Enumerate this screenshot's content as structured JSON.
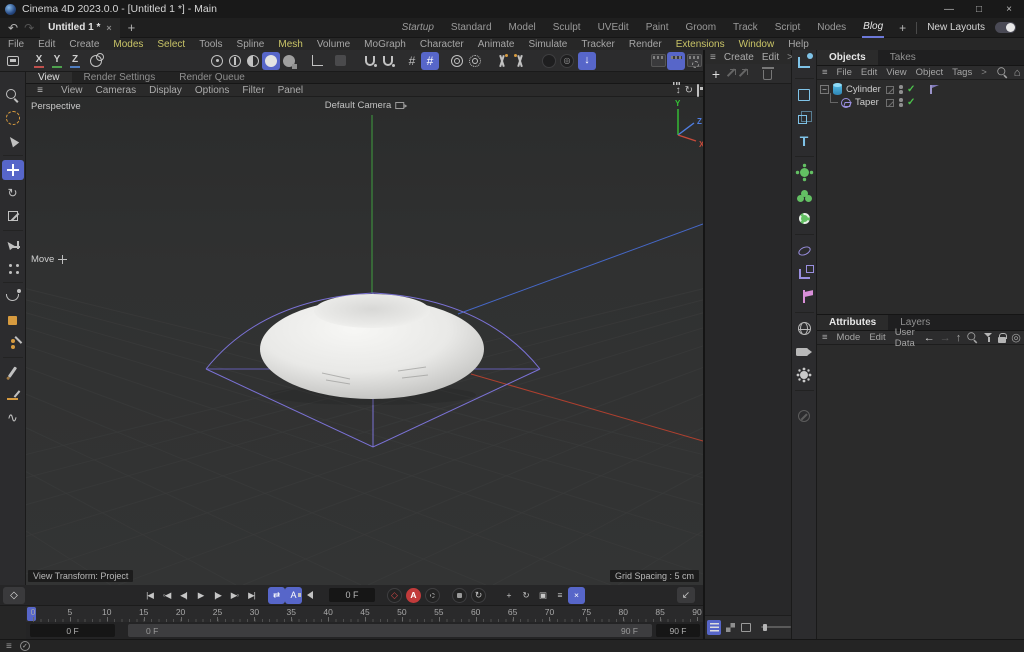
{
  "icons": {
    "hamburger": "≡",
    "check": "✓",
    "home": "⌂",
    "target": "◎",
    "rotate": "↻",
    "wave": "∿",
    "down_arrow": "↓",
    "grid": "#",
    "text_tool": "T",
    "updown": "↕",
    "plus": "+",
    "scale_arrow": "↔",
    "param": "▤",
    "box": "▣",
    "cross": "×"
  },
  "titlebar": {
    "title": "Cinema 4D 2023.0.0 - [Untitled 1 *] - Main",
    "minimize": "—",
    "maximize": "□",
    "close": "×"
  },
  "tabbar": {
    "undo": "↶",
    "redo": "↷",
    "document": "Untitled 1 *",
    "close": "×",
    "add": "+",
    "layouts": [
      {
        "label": "Startup",
        "italic": true
      },
      {
        "label": "Standard"
      },
      {
        "label": "Model"
      },
      {
        "label": "Sculpt"
      },
      {
        "label": "UVEdit"
      },
      {
        "label": "Paint"
      },
      {
        "label": "Groom"
      },
      {
        "label": "Track"
      },
      {
        "label": "Script"
      },
      {
        "label": "Nodes"
      },
      {
        "label": "Blog",
        "italic": true,
        "active": true
      }
    ],
    "add_layout": "+",
    "new_layouts": "New Layouts"
  },
  "menubar": {
    "items": [
      {
        "label": "File"
      },
      {
        "label": "Edit"
      },
      {
        "label": "Create"
      },
      {
        "label": "Modes",
        "hl": true
      },
      {
        "label": "Select",
        "hl": true
      },
      {
        "label": "Tools"
      },
      {
        "label": "Spline"
      },
      {
        "label": "Mesh",
        "hl": true
      },
      {
        "label": "Volume"
      },
      {
        "label": "MoGraph"
      },
      {
        "label": "Character"
      },
      {
        "label": "Animate"
      },
      {
        "label": "Simulate"
      },
      {
        "label": "Tracker"
      },
      {
        "label": "Render"
      },
      {
        "label": "Extensions",
        "hl": true
      },
      {
        "label": "Window",
        "hl": true
      },
      {
        "label": "Help"
      }
    ]
  },
  "toolbar": {
    "axis_x": "X",
    "axis_y": "Y",
    "axis_z": "Z"
  },
  "viewport": {
    "tabs": [
      {
        "label": "View",
        "active": true
      },
      {
        "label": "Render Settings"
      },
      {
        "label": "Render Queue"
      }
    ],
    "menu": [
      "View",
      "Cameras",
      "Display",
      "Options",
      "Filter",
      "Panel"
    ],
    "projection": "Perspective",
    "camera": "Default Camera",
    "tool_hint": "Move",
    "info_left": "View Transform: Project",
    "info_right": "Grid Spacing : 5 cm",
    "axis": {
      "x": "X",
      "y": "Y",
      "z": "Z"
    }
  },
  "materials_panel": {
    "menu": [
      "Create",
      "Edit",
      ">"
    ],
    "add": "+"
  },
  "objects_panel": {
    "tabs": [
      {
        "label": "Objects",
        "active": true
      },
      {
        "label": "Takes"
      }
    ],
    "menu": [
      "File",
      "Edit",
      "View",
      "Object",
      "Tags",
      ">"
    ],
    "expander": "−",
    "tree": [
      {
        "name": "Cylinder"
      },
      {
        "name": "Taper"
      }
    ]
  },
  "attributes_panel": {
    "tabs": [
      {
        "label": "Attributes",
        "active": true
      },
      {
        "label": "Layers"
      }
    ],
    "menu": [
      "Mode",
      "Edit",
      "User Data"
    ],
    "nav_back": "←",
    "nav_fwd": "→",
    "nav_up": "↑"
  },
  "timeline": {
    "ticks": [
      "0",
      "5",
      "10",
      "15",
      "20",
      "25",
      "30",
      "35",
      "40",
      "45",
      "50",
      "55",
      "60",
      "65",
      "70",
      "75",
      "80",
      "85",
      "90"
    ],
    "transport": [
      {
        "glyph": "|◀"
      },
      {
        "glyph": "◦◀"
      },
      {
        "glyph": "◀|"
      },
      {
        "glyph": "▶"
      },
      {
        "glyph": "|▶"
      },
      {
        "glyph": "▶◦"
      },
      {
        "glyph": "▶|"
      }
    ],
    "loop_glyph": "⇄",
    "autokey_letter": "A",
    "keyframe_glyph": "◇",
    "record_diamond": "◇",
    "expand_glyph": "↙",
    "current_frame": "0 F",
    "range_start": "0 F",
    "range_end": "90 F",
    "end_frame": "90 F"
  }
}
